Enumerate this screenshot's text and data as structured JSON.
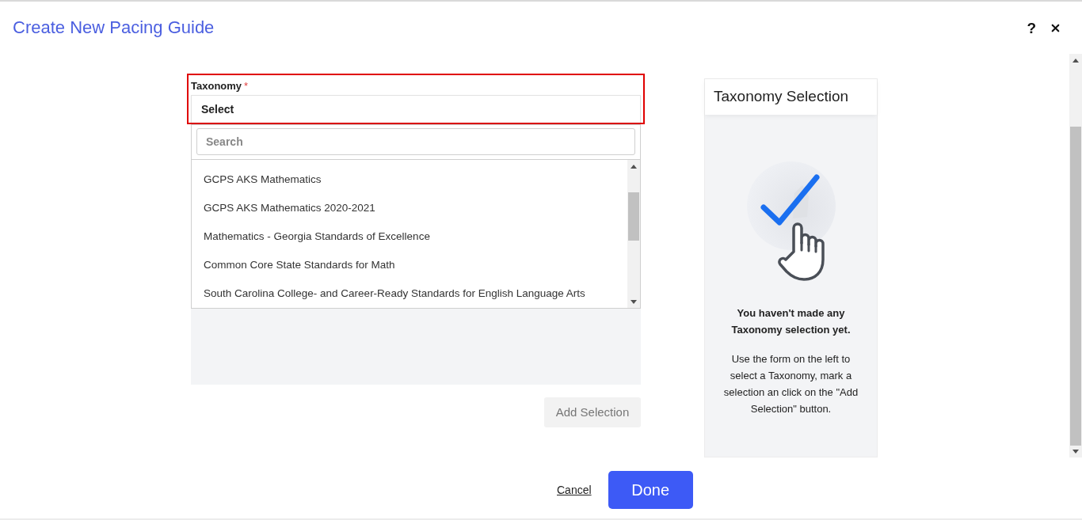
{
  "dialog": {
    "title": "Create New Pacing Guide",
    "help_label": "?"
  },
  "taxonomy_field": {
    "label": "Taxonomy",
    "required_mark": "*",
    "value": "Select",
    "invalid": true,
    "expanded": true
  },
  "dropdown": {
    "search_placeholder": "Search",
    "options": [
      {
        "label": "GCPS AKS Mathematics",
        "selected": false
      },
      {
        "label": "GCPS AKS Mathematics 2020-2021",
        "selected": false
      },
      {
        "label": "Mathematics - Georgia Standards of Excellence",
        "selected": false
      },
      {
        "label": "Common Core State Standards for Math",
        "selected": false
      },
      {
        "label": "South Carolina College- and Career-Ready Standards for English Language Arts",
        "selected": false
      }
    ]
  },
  "add_button": {
    "label": "Add Selection",
    "disabled": true
  },
  "summary_card": {
    "title": "Taxonomy Selection",
    "empty_heading": "You haven't made any Taxonomy selection yet.",
    "empty_text": "Use the form on the left to select a Taxonomy, mark a selection an click on the \"Add Selection\" button."
  },
  "footer": {
    "cancel": "Cancel",
    "done": "Done"
  }
}
